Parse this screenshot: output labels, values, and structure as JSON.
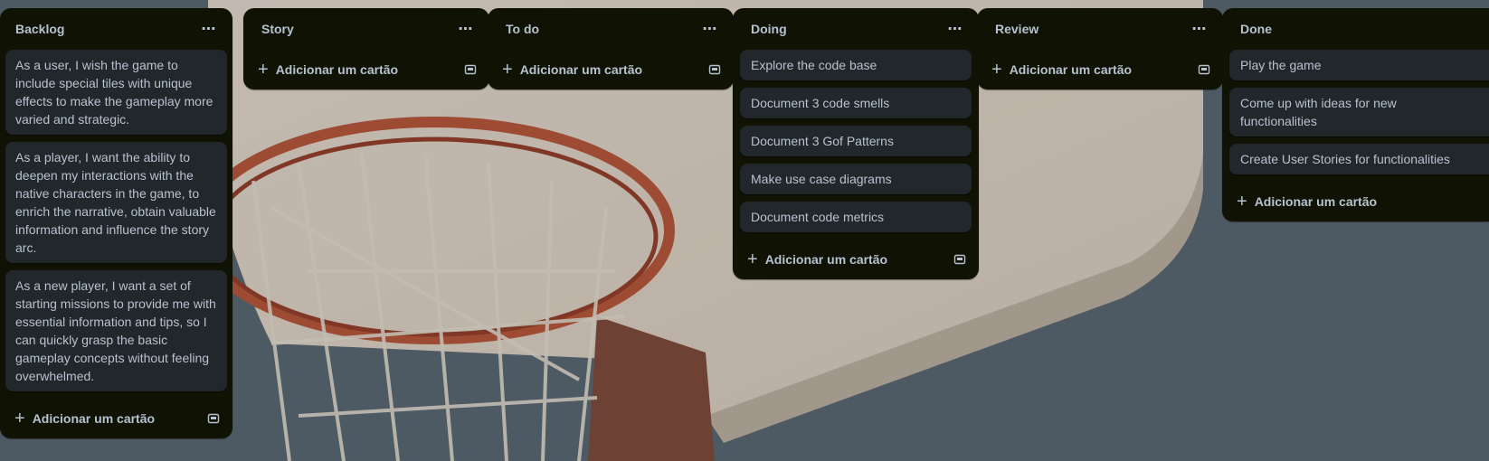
{
  "board": {
    "lists": [
      {
        "title": "Backlog",
        "cards": [
          "As a user, I wish the game to include special tiles with unique effects to make the gameplay more varied and strategic.",
          "As a player, I want the ability to deepen my interactions with the native characters in the game, to enrich the narrative, obtain valuable information and influence the story arc.",
          "As a new player, I want a set of starting missions to provide me with essential information and tips, so I can quickly grasp the basic gameplay concepts without feeling overwhelmed."
        ],
        "add_label": "Adicionar um cartão"
      },
      {
        "title": "Story",
        "cards": [],
        "add_label": "Adicionar um cartão"
      },
      {
        "title": "To do",
        "cards": [],
        "add_label": "Adicionar um cartão"
      },
      {
        "title": "Doing",
        "cards": [
          "Explore the code base",
          "Document 3 code smells",
          "Document 3 Gof Patterns",
          "Make use case diagrams",
          "Document code metrics"
        ],
        "add_label": "Adicionar um cartão"
      },
      {
        "title": "Review",
        "cards": [],
        "add_label": "Adicionar um cartão"
      },
      {
        "title": "Done",
        "cards": [
          "Play the game",
          "Come up with ideas for new functionalities",
          "Create User Stories for functionalities"
        ],
        "add_label": "Adicionar um cartão"
      }
    ]
  },
  "icons": {
    "more": "more-horizontal-icon",
    "add": "plus-icon",
    "template": "card-template-icon"
  },
  "colors": {
    "list_bg": "#101204",
    "card_bg": "#22272b",
    "text": "#b6c2cf"
  }
}
